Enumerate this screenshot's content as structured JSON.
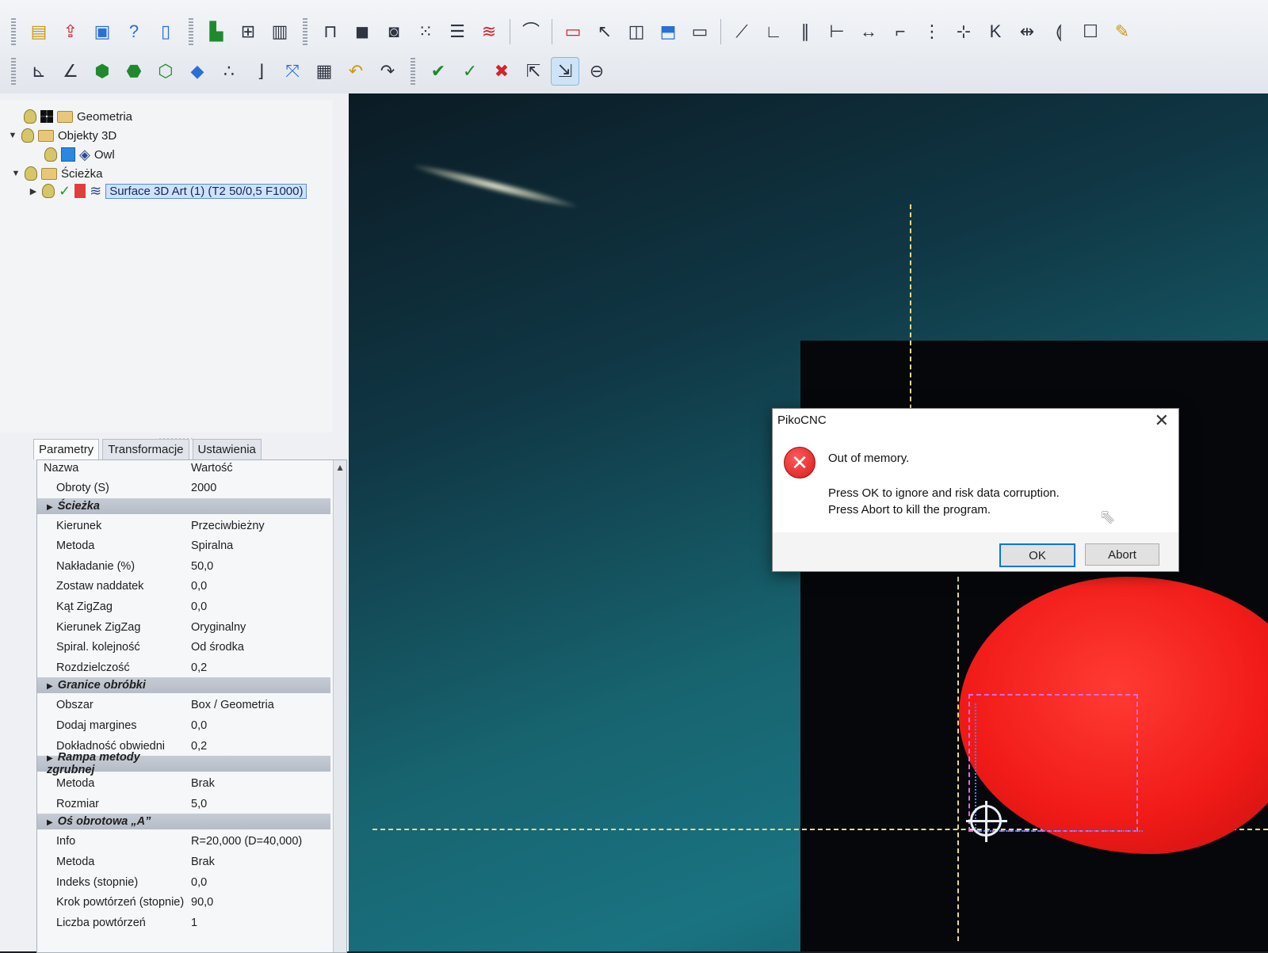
{
  "app": {
    "name": "PikoCNC"
  },
  "toolbar": {
    "row1": [
      "open-folder-icon",
      "import-icon",
      "save-icon",
      "help-icon",
      "new-document-icon",
      "chart-colored-icon",
      "grid-view-icon",
      "bar-chart-icon",
      "pocket-icon",
      "square-icon",
      "offset-square-icon",
      "dot-grid-icon",
      "lines-icon",
      "path-icon",
      "curve-icon",
      "rectangle-icon",
      "pointer-icon",
      "cube-icon",
      "shape-icon",
      "window-icon"
    ],
    "row2_left": [
      "axis-icon",
      "axis-alt-icon",
      "view-front-icon",
      "view-top-icon",
      "view-side-icon",
      "view-iso-icon",
      "points-icon",
      "corner-icon",
      "fit-icon",
      "mesh-icon",
      "undo-icon",
      "redo-icon"
    ],
    "row2_right": [
      "check-icon",
      "check-all-icon",
      "delete-icon",
      "select-icon",
      "select-multi-icon",
      "link-icon",
      "line-edit-icon",
      "angle-icon",
      "parallel-icon",
      "perpendicular-icon",
      "distance-icon",
      "join-icon",
      "vertical-dots-icon",
      "center-icon",
      "k-icon",
      "mirror-icon",
      "constraint-icon",
      "edit-box-icon",
      "brush-icon"
    ]
  },
  "tree": {
    "items": [
      {
        "label": "Geometria"
      },
      {
        "label": "Objekty 3D"
      },
      {
        "label": "Owl"
      },
      {
        "label": "Ścieżka"
      },
      {
        "label": "Surface 3D Art (1) (T2 50/0,5 F1000)"
      }
    ]
  },
  "tabs": [
    "Parametry",
    "Transformacje",
    "Ustawienia"
  ],
  "properties": {
    "header": {
      "name": "Nazwa",
      "value": "Wartość"
    },
    "rows": [
      {
        "name": "Obroty (S)",
        "value": "2000",
        "group": false
      },
      {
        "name": "Ścieżka",
        "value": "",
        "group": true
      },
      {
        "name": "Kierunek",
        "value": "Przeciwbieżny",
        "group": false
      },
      {
        "name": "Metoda",
        "value": "Spiralna",
        "group": false
      },
      {
        "name": "Nakładanie (%)",
        "value": "50,0",
        "group": false
      },
      {
        "name": "Zostaw naddatek",
        "value": "0,0",
        "group": false
      },
      {
        "name": "Kąt ZigZag",
        "value": "0,0",
        "group": false
      },
      {
        "name": "Kierunek ZigZag",
        "value": "Oryginalny",
        "group": false
      },
      {
        "name": "Spiral. kolejność",
        "value": "Od środka",
        "group": false
      },
      {
        "name": "Rozdzielczość",
        "value": "0,2",
        "group": false
      },
      {
        "name": "Granice obróbki",
        "value": "",
        "group": true
      },
      {
        "name": "Obszar",
        "value": "Box / Geometria",
        "group": false
      },
      {
        "name": "Dodaj margines",
        "value": "0,0",
        "group": false
      },
      {
        "name": "Dokładność obwiedni",
        "value": "0,2",
        "group": false
      },
      {
        "name": "Rampa metody zgrubnej",
        "value": "",
        "group": true
      },
      {
        "name": "Metoda",
        "value": "Brak",
        "group": false
      },
      {
        "name": "Rozmiar",
        "value": "5,0",
        "group": false
      },
      {
        "name": "Oś obrotowa „A”",
        "value": "",
        "group": true
      },
      {
        "name": "Info",
        "value": "R=20,000 (D=40,000)",
        "group": false
      },
      {
        "name": "Metoda",
        "value": "Brak",
        "group": false
      },
      {
        "name": "Indeks (stopnie)",
        "value": "0,0",
        "group": false
      },
      {
        "name": "Krok powtórzeń (stopnie)",
        "value": "90,0",
        "group": false
      },
      {
        "name": "Liczba powtórzeń",
        "value": "1",
        "group": false
      }
    ]
  },
  "dialog": {
    "title": "PikoCNC",
    "message": "Out of memory.",
    "detail_line1": "Press OK to ignore and risk data corruption.",
    "detail_line2": "Press Abort to kill the program.",
    "ok_label": "OK",
    "abort_label": "Abort",
    "close_glyph": "✕"
  },
  "colors": {
    "model": "#f11b18",
    "viewport": "#17646f",
    "selection": "#e36bd9",
    "axis": "#e6d98a"
  }
}
